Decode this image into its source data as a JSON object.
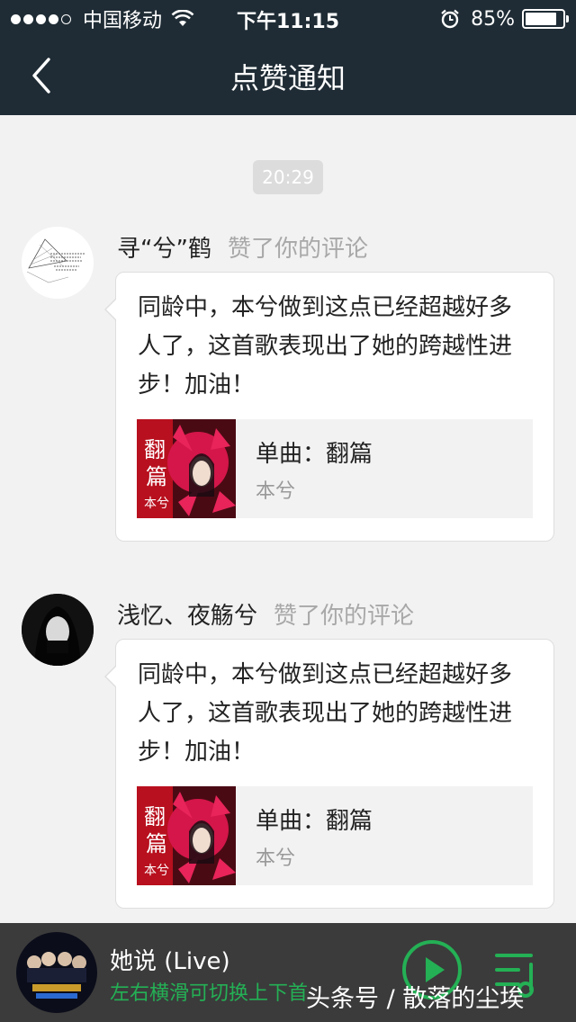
{
  "status_bar": {
    "carrier": "中国移动",
    "time": "下午11:15",
    "battery_text": "85%",
    "battery_level": 0.85,
    "signal_bars": 4
  },
  "nav": {
    "title": "点赞通知",
    "back_icon": "chevron-left-icon"
  },
  "time_badge": "20:29",
  "notifications": [
    {
      "user": "寻“兮”鹤",
      "action": "赞了你的评论",
      "comment": "同龄中，本兮做到这点已经超越好多人了，这首歌表现出了她的跨越性进步！加油！",
      "song": {
        "label": "单曲：翻篇",
        "artist": "本兮"
      }
    },
    {
      "user": "浅忆、夜觞兮",
      "action": "赞了你的评论",
      "comment": "同龄中，本兮做到这点已经超越好多人了，这首歌表现出了她的跨越性进步！加油！",
      "song": {
        "label": "单曲：翻篇",
        "artist": "本兮"
      }
    }
  ],
  "player": {
    "title": "她说 (Live)",
    "hint": "左右横滑可切换上下首",
    "accent": "#24b055"
  },
  "watermark": "头条号 / 散落的尘埃",
  "colors": {
    "header_bg": "#1f2c35",
    "page_bg": "#f2f2f2",
    "player_bg": "#3b3b3b"
  }
}
